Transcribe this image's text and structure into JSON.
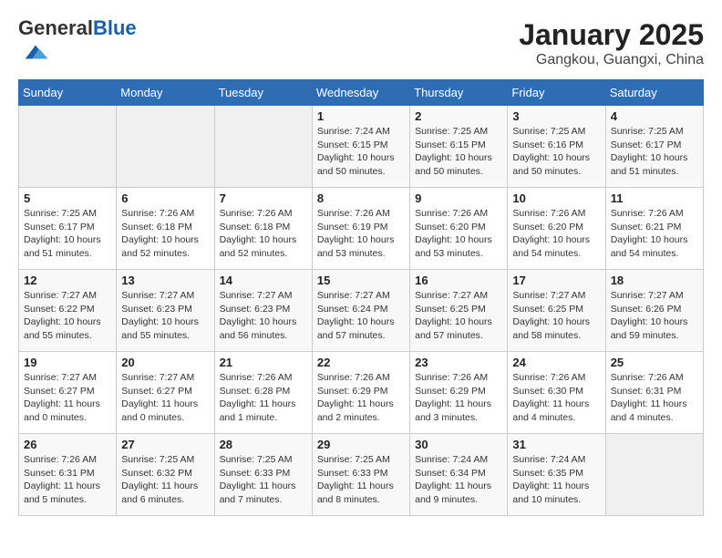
{
  "header": {
    "logo_general": "General",
    "logo_blue": "Blue",
    "month_year": "January 2025",
    "location": "Gangkou, Guangxi, China"
  },
  "weekdays": [
    "Sunday",
    "Monday",
    "Tuesday",
    "Wednesday",
    "Thursday",
    "Friday",
    "Saturday"
  ],
  "weeks": [
    [
      {
        "day": "",
        "sunrise": "",
        "sunset": "",
        "daylight": ""
      },
      {
        "day": "",
        "sunrise": "",
        "sunset": "",
        "daylight": ""
      },
      {
        "day": "",
        "sunrise": "",
        "sunset": "",
        "daylight": ""
      },
      {
        "day": "1",
        "sunrise": "Sunrise: 7:24 AM",
        "sunset": "Sunset: 6:15 PM",
        "daylight": "Daylight: 10 hours and 50 minutes."
      },
      {
        "day": "2",
        "sunrise": "Sunrise: 7:25 AM",
        "sunset": "Sunset: 6:15 PM",
        "daylight": "Daylight: 10 hours and 50 minutes."
      },
      {
        "day": "3",
        "sunrise": "Sunrise: 7:25 AM",
        "sunset": "Sunset: 6:16 PM",
        "daylight": "Daylight: 10 hours and 50 minutes."
      },
      {
        "day": "4",
        "sunrise": "Sunrise: 7:25 AM",
        "sunset": "Sunset: 6:17 PM",
        "daylight": "Daylight: 10 hours and 51 minutes."
      }
    ],
    [
      {
        "day": "5",
        "sunrise": "Sunrise: 7:25 AM",
        "sunset": "Sunset: 6:17 PM",
        "daylight": "Daylight: 10 hours and 51 minutes."
      },
      {
        "day": "6",
        "sunrise": "Sunrise: 7:26 AM",
        "sunset": "Sunset: 6:18 PM",
        "daylight": "Daylight: 10 hours and 52 minutes."
      },
      {
        "day": "7",
        "sunrise": "Sunrise: 7:26 AM",
        "sunset": "Sunset: 6:18 PM",
        "daylight": "Daylight: 10 hours and 52 minutes."
      },
      {
        "day": "8",
        "sunrise": "Sunrise: 7:26 AM",
        "sunset": "Sunset: 6:19 PM",
        "daylight": "Daylight: 10 hours and 53 minutes."
      },
      {
        "day": "9",
        "sunrise": "Sunrise: 7:26 AM",
        "sunset": "Sunset: 6:20 PM",
        "daylight": "Daylight: 10 hours and 53 minutes."
      },
      {
        "day": "10",
        "sunrise": "Sunrise: 7:26 AM",
        "sunset": "Sunset: 6:20 PM",
        "daylight": "Daylight: 10 hours and 54 minutes."
      },
      {
        "day": "11",
        "sunrise": "Sunrise: 7:26 AM",
        "sunset": "Sunset: 6:21 PM",
        "daylight": "Daylight: 10 hours and 54 minutes."
      }
    ],
    [
      {
        "day": "12",
        "sunrise": "Sunrise: 7:27 AM",
        "sunset": "Sunset: 6:22 PM",
        "daylight": "Daylight: 10 hours and 55 minutes."
      },
      {
        "day": "13",
        "sunrise": "Sunrise: 7:27 AM",
        "sunset": "Sunset: 6:23 PM",
        "daylight": "Daylight: 10 hours and 55 minutes."
      },
      {
        "day": "14",
        "sunrise": "Sunrise: 7:27 AM",
        "sunset": "Sunset: 6:23 PM",
        "daylight": "Daylight: 10 hours and 56 minutes."
      },
      {
        "day": "15",
        "sunrise": "Sunrise: 7:27 AM",
        "sunset": "Sunset: 6:24 PM",
        "daylight": "Daylight: 10 hours and 57 minutes."
      },
      {
        "day": "16",
        "sunrise": "Sunrise: 7:27 AM",
        "sunset": "Sunset: 6:25 PM",
        "daylight": "Daylight: 10 hours and 57 minutes."
      },
      {
        "day": "17",
        "sunrise": "Sunrise: 7:27 AM",
        "sunset": "Sunset: 6:25 PM",
        "daylight": "Daylight: 10 hours and 58 minutes."
      },
      {
        "day": "18",
        "sunrise": "Sunrise: 7:27 AM",
        "sunset": "Sunset: 6:26 PM",
        "daylight": "Daylight: 10 hours and 59 minutes."
      }
    ],
    [
      {
        "day": "19",
        "sunrise": "Sunrise: 7:27 AM",
        "sunset": "Sunset: 6:27 PM",
        "daylight": "Daylight: 11 hours and 0 minutes."
      },
      {
        "day": "20",
        "sunrise": "Sunrise: 7:27 AM",
        "sunset": "Sunset: 6:27 PM",
        "daylight": "Daylight: 11 hours and 0 minutes."
      },
      {
        "day": "21",
        "sunrise": "Sunrise: 7:26 AM",
        "sunset": "Sunset: 6:28 PM",
        "daylight": "Daylight: 11 hours and 1 minute."
      },
      {
        "day": "22",
        "sunrise": "Sunrise: 7:26 AM",
        "sunset": "Sunset: 6:29 PM",
        "daylight": "Daylight: 11 hours and 2 minutes."
      },
      {
        "day": "23",
        "sunrise": "Sunrise: 7:26 AM",
        "sunset": "Sunset: 6:29 PM",
        "daylight": "Daylight: 11 hours and 3 minutes."
      },
      {
        "day": "24",
        "sunrise": "Sunrise: 7:26 AM",
        "sunset": "Sunset: 6:30 PM",
        "daylight": "Daylight: 11 hours and 4 minutes."
      },
      {
        "day": "25",
        "sunrise": "Sunrise: 7:26 AM",
        "sunset": "Sunset: 6:31 PM",
        "daylight": "Daylight: 11 hours and 4 minutes."
      }
    ],
    [
      {
        "day": "26",
        "sunrise": "Sunrise: 7:26 AM",
        "sunset": "Sunset: 6:31 PM",
        "daylight": "Daylight: 11 hours and 5 minutes."
      },
      {
        "day": "27",
        "sunrise": "Sunrise: 7:25 AM",
        "sunset": "Sunset: 6:32 PM",
        "daylight": "Daylight: 11 hours and 6 minutes."
      },
      {
        "day": "28",
        "sunrise": "Sunrise: 7:25 AM",
        "sunset": "Sunset: 6:33 PM",
        "daylight": "Daylight: 11 hours and 7 minutes."
      },
      {
        "day": "29",
        "sunrise": "Sunrise: 7:25 AM",
        "sunset": "Sunset: 6:33 PM",
        "daylight": "Daylight: 11 hours and 8 minutes."
      },
      {
        "day": "30",
        "sunrise": "Sunrise: 7:24 AM",
        "sunset": "Sunset: 6:34 PM",
        "daylight": "Daylight: 11 hours and 9 minutes."
      },
      {
        "day": "31",
        "sunrise": "Sunrise: 7:24 AM",
        "sunset": "Sunset: 6:35 PM",
        "daylight": "Daylight: 11 hours and 10 minutes."
      },
      {
        "day": "",
        "sunrise": "",
        "sunset": "",
        "daylight": ""
      }
    ]
  ]
}
